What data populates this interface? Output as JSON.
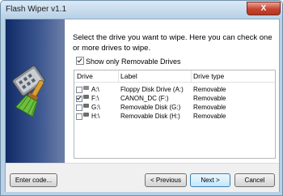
{
  "window": {
    "title": "Flash Wiper v1.1",
    "close_label": "X"
  },
  "main": {
    "instructions": "Select the drive you want to wipe. Here you can check one or more drives to wipe.",
    "filter": {
      "label": "Show only Removable Drives",
      "checked": true
    }
  },
  "drive_list": {
    "columns": {
      "drive": "Drive",
      "label": "Label",
      "type": "Drive type"
    },
    "rows": [
      {
        "drive": "A:\\",
        "label": "Floppy Disk Drive (A:)",
        "type": "Removable",
        "checked": false,
        "icon": "floppy-drive-icon"
      },
      {
        "drive": "F:\\",
        "label": "CANON_DC (F:)",
        "type": "Removable",
        "checked": true,
        "icon": "removable-drive-icon"
      },
      {
        "drive": "G:\\",
        "label": "Removable Disk (G:)",
        "type": "Removable",
        "checked": false,
        "icon": "removable-drive-icon"
      },
      {
        "drive": "H:\\",
        "label": "Removable Disk (H:)",
        "type": "Removable",
        "checked": false,
        "icon": "removable-drive-icon"
      }
    ]
  },
  "footer": {
    "enter_code": "Enter code...",
    "previous": "< Previous",
    "next": "Next >",
    "cancel": "Cancel"
  },
  "colors": {
    "sidebar_top": "#102a66",
    "sidebar_bottom": "#6d7fa8",
    "title_bar": "#c9ddf0",
    "close_button": "#c6442f"
  }
}
